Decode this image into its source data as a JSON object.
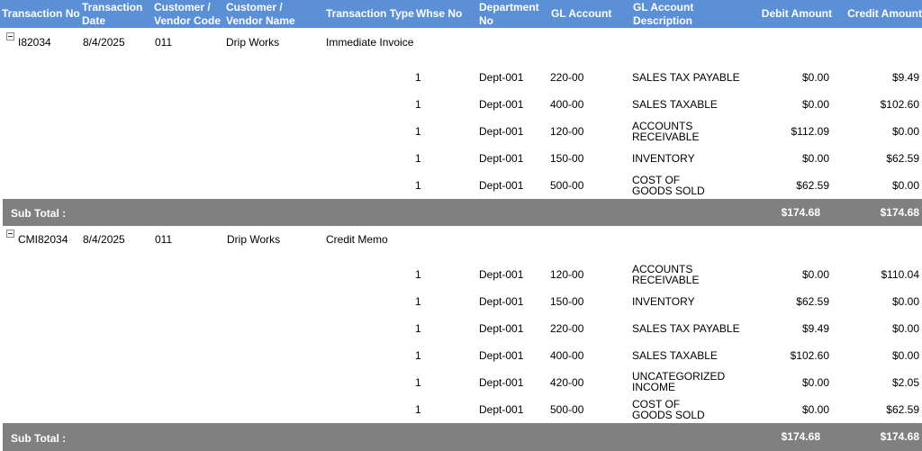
{
  "columns": [
    {
      "key": "transaction_no",
      "label": "Transaction No"
    },
    {
      "key": "transaction_date",
      "label": "Transaction Date"
    },
    {
      "key": "customer_code",
      "label": "Customer / Vendor Code"
    },
    {
      "key": "customer_name",
      "label": "Customer / Vendor Name"
    },
    {
      "key": "transaction_type",
      "label": "Transaction Type"
    },
    {
      "key": "whse_no",
      "label": "Whse No"
    },
    {
      "key": "department_no",
      "label": "Department No"
    },
    {
      "key": "gl_account",
      "label": "GL Account"
    },
    {
      "key": "gl_description",
      "label": "GL Account Description"
    },
    {
      "key": "debit",
      "label": "Debit Amount"
    },
    {
      "key": "credit",
      "label": "Credit Amount"
    }
  ],
  "groups": [
    {
      "transaction_no": "I82034",
      "date": "8/4/2025",
      "code": "011",
      "name": "Drip Works",
      "type": "Immediate Invoice",
      "rows": [
        {
          "whse": "1",
          "dept": "Dept-001",
          "gl": "220-00",
          "desc": "SALES TAX PAYABLE",
          "debit": "$0.00",
          "credit": "$9.49"
        },
        {
          "whse": "1",
          "dept": "Dept-001",
          "gl": "400-00",
          "desc": "SALES TAXABLE",
          "debit": "$0.00",
          "credit": "$102.60"
        },
        {
          "whse": "1",
          "dept": "Dept-001",
          "gl": "120-00",
          "desc": "ACCOUNTS RECEIVABLE",
          "debit": "$112.09",
          "credit": "$0.00"
        },
        {
          "whse": "1",
          "dept": "Dept-001",
          "gl": "150-00",
          "desc": "INVENTORY",
          "debit": "$0.00",
          "credit": "$62.59"
        },
        {
          "whse": "1",
          "dept": "Dept-001",
          "gl": "500-00",
          "desc": "COST OF GOODS SOLD",
          "debit": "$62.59",
          "credit": "$0.00"
        }
      ],
      "subtotal": {
        "label": "Sub Total :",
        "debit": "$174.68",
        "credit": "$174.68"
      }
    },
    {
      "transaction_no": "CMI82034",
      "date": "8/4/2025",
      "code": "011",
      "name": "Drip Works",
      "type": "Credit Memo",
      "rows": [
        {
          "whse": "1",
          "dept": "Dept-001",
          "gl": "120-00",
          "desc": "ACCOUNTS RECEIVABLE",
          "debit": "$0.00",
          "credit": "$110.04"
        },
        {
          "whse": "1",
          "dept": "Dept-001",
          "gl": "150-00",
          "desc": "INVENTORY",
          "debit": "$62.59",
          "credit": "$0.00"
        },
        {
          "whse": "1",
          "dept": "Dept-001",
          "gl": "220-00",
          "desc": "SALES TAX PAYABLE",
          "debit": "$9.49",
          "credit": "$0.00"
        },
        {
          "whse": "1",
          "dept": "Dept-001",
          "gl": "400-00",
          "desc": "SALES TAXABLE",
          "debit": "$102.60",
          "credit": "$0.00"
        },
        {
          "whse": "1",
          "dept": "Dept-001",
          "gl": "420-00",
          "desc": "UNCATEGORIZED INCOME",
          "debit": "$0.00",
          "credit": "$2.05"
        },
        {
          "whse": "1",
          "dept": "Dept-001",
          "gl": "500-00",
          "desc": "COST OF GOODS SOLD",
          "debit": "$0.00",
          "credit": "$62.59"
        }
      ],
      "subtotal": {
        "label": "Sub Total :",
        "debit": "$174.68",
        "credit": "$174.68"
      }
    }
  ]
}
